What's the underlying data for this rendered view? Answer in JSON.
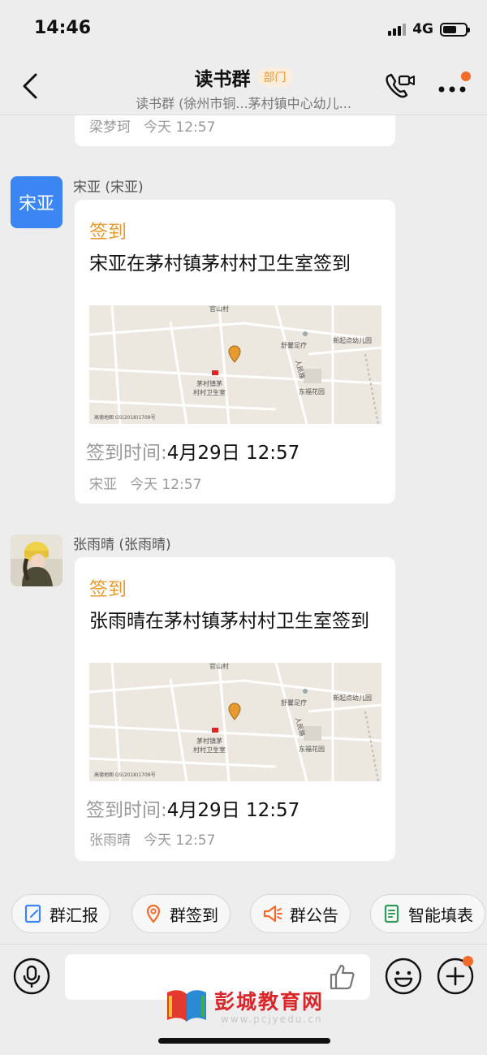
{
  "status_bar": {
    "time": "14:46",
    "network": "4G"
  },
  "header": {
    "title": "读书群",
    "badge": "部门",
    "subtitle": "读书群 (徐州市铜...茅村镇中心幼儿..."
  },
  "messages": [
    {
      "footer_name": "梁梦珂",
      "footer_time": "今天 12:57"
    },
    {
      "sender": "宋亚 (宋亚)",
      "avatar_text": "宋亚",
      "card_title": "签到",
      "card_body": "宋亚在茅村镇茅村村卫生室签到",
      "checkin_label": "签到时间:",
      "checkin_value": "4月29日 12:57",
      "footer_name": "宋亚",
      "footer_time": "今天 12:57"
    },
    {
      "sender": "张雨晴 (张雨晴)",
      "avatar_text": "",
      "card_title": "签到",
      "card_body": "张雨晴在茅村镇茅村村卫生室签到",
      "checkin_label": "签到时间:",
      "checkin_value": "4月29日 12:57",
      "footer_name": "张雨晴",
      "footer_time": "今天 12:57"
    }
  ],
  "map": {
    "labels": {
      "village": "官山村",
      "shop": "舒馨足疗",
      "kindergarten": "新起点幼儿园",
      "road": "人民路",
      "clinic_line1": "茅村镇茅",
      "clinic_line2": "村村卫生室",
      "garden": "东福花园",
      "copyright": "高德地图 GS(2018)1709号"
    },
    "colors": {
      "land": "#ece7df",
      "road": "#ffffff",
      "pin": "#e79a2d"
    }
  },
  "quick_actions": [
    {
      "label": "群汇报",
      "icon": "report-icon"
    },
    {
      "label": "群签到",
      "icon": "location-pin-icon"
    },
    {
      "label": "群公告",
      "icon": "megaphone-icon"
    },
    {
      "label": "智能填表",
      "icon": "form-icon"
    }
  ],
  "watermark": {
    "name": "彭城教育网",
    "url": "www.pcjyedu.cn"
  },
  "colors": {
    "accent": "#e79a2d",
    "notice_dot": "#f26b2a",
    "avatar_blue": "#3b86f2",
    "icon_blue": "#3b86f2",
    "icon_orange": "#f26b2a",
    "icon_green": "#2f9a5a"
  }
}
